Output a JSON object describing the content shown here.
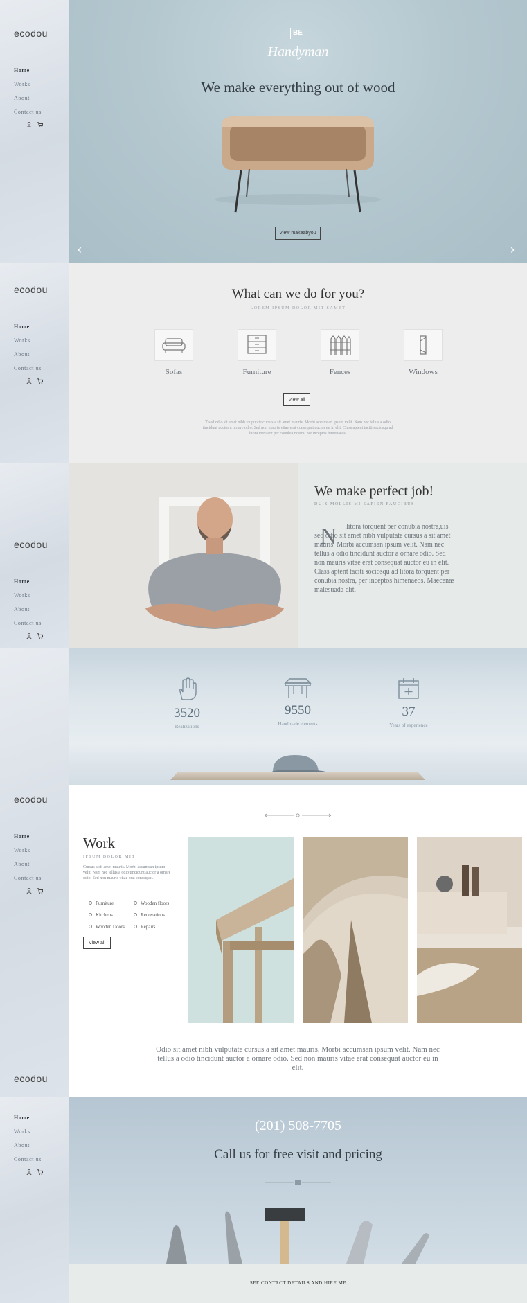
{
  "sidebar": {
    "logo": "ecodou",
    "nav": [
      "Home",
      "Works",
      "About",
      "Contact us"
    ],
    "icons": [
      "user-icon",
      "cart-icon"
    ]
  },
  "hero": {
    "badge": "BE",
    "brand": "Handyman",
    "title": "We make everything out of wood",
    "button": "View makeabyou",
    "prev": "‹",
    "next": "›"
  },
  "services": {
    "title": "What can we do for you?",
    "subtitle": "LOREM IPSUM DOLOR MIT SAMET",
    "items": [
      {
        "label": "Sofas",
        "icon": "sofa-icon"
      },
      {
        "label": "Furniture",
        "icon": "drawer-icon"
      },
      {
        "label": "Fences",
        "icon": "fence-icon"
      },
      {
        "label": "Windows",
        "icon": "window-icon"
      }
    ],
    "button": "View all",
    "text": "T sed odio sit amet nibh vulputate cursus a sit amet mauris. Morbi accumsan ipsum velit. Nam nec tellus a odio tincidunt auctor a ornare odio. Sed non mauris vitae erat consequat auctor eu in elit. Class aptent taciti sociosqu ad litora torquent per conubia nostra, per inceptos himenaeos."
  },
  "about": {
    "title": "We make perfect job!",
    "subtitle": "DUIS MOLLIS MI SAPIEN FAUCIBUS",
    "dropcap": "N",
    "text": "litora torquent per conubia nostra,uis sed odio sit amet nibh vulputate cursus a sit amet mauris. Morbi accumsan ipsum velit. Nam nec tellus a odio tincidunt auctor a ornare odio. Sed non mauris vitae erat consequat auctor eu in elit. Class aptent taciti sociosqu ad litora torquent per conubia nostra, per inceptos himenaeos. Maecenas malesuada elit."
  },
  "stats": [
    {
      "value": "3520",
      "caption": "Realizations",
      "icon": "hand-icon"
    },
    {
      "value": "9550",
      "caption": "Handmade elements",
      "icon": "table-icon"
    },
    {
      "value": "37",
      "caption": "Years of experience",
      "icon": "calendar-icon"
    }
  ],
  "work": {
    "title": "Work",
    "subtitle": "IPSUM DOLOR MIT",
    "desc": "Cursus a sit amet mauris. Morbi accumsan ipsum velit. Nam nec tellus a odio tincidunt auctor a ornare odio. Sed non mauris vitae erat consequat.",
    "list": [
      "Furniture",
      "Wooden floors",
      "Kitchens",
      "Renovations",
      "Wooden Doors",
      "Repairs"
    ],
    "button": "View all",
    "paragraph": "Odio sit amet nibh vulputate cursus a sit amet mauris. Morbi accumsan ipsum velit. Nam nec tellus a odio tincidunt auctor a ornare odio. Sed non mauris vitae erat consequat auctor eu in elit."
  },
  "contact": {
    "phone": "(201) 508-7705",
    "cta": "Call us for free visit and pricing",
    "footer": "SEE CONTACT DETAILS AND HIRE ME"
  },
  "colors": {
    "hero_bg": "#b5c8d0",
    "text_dark": "#343c43",
    "accent_blue": "#5a6d7a"
  }
}
